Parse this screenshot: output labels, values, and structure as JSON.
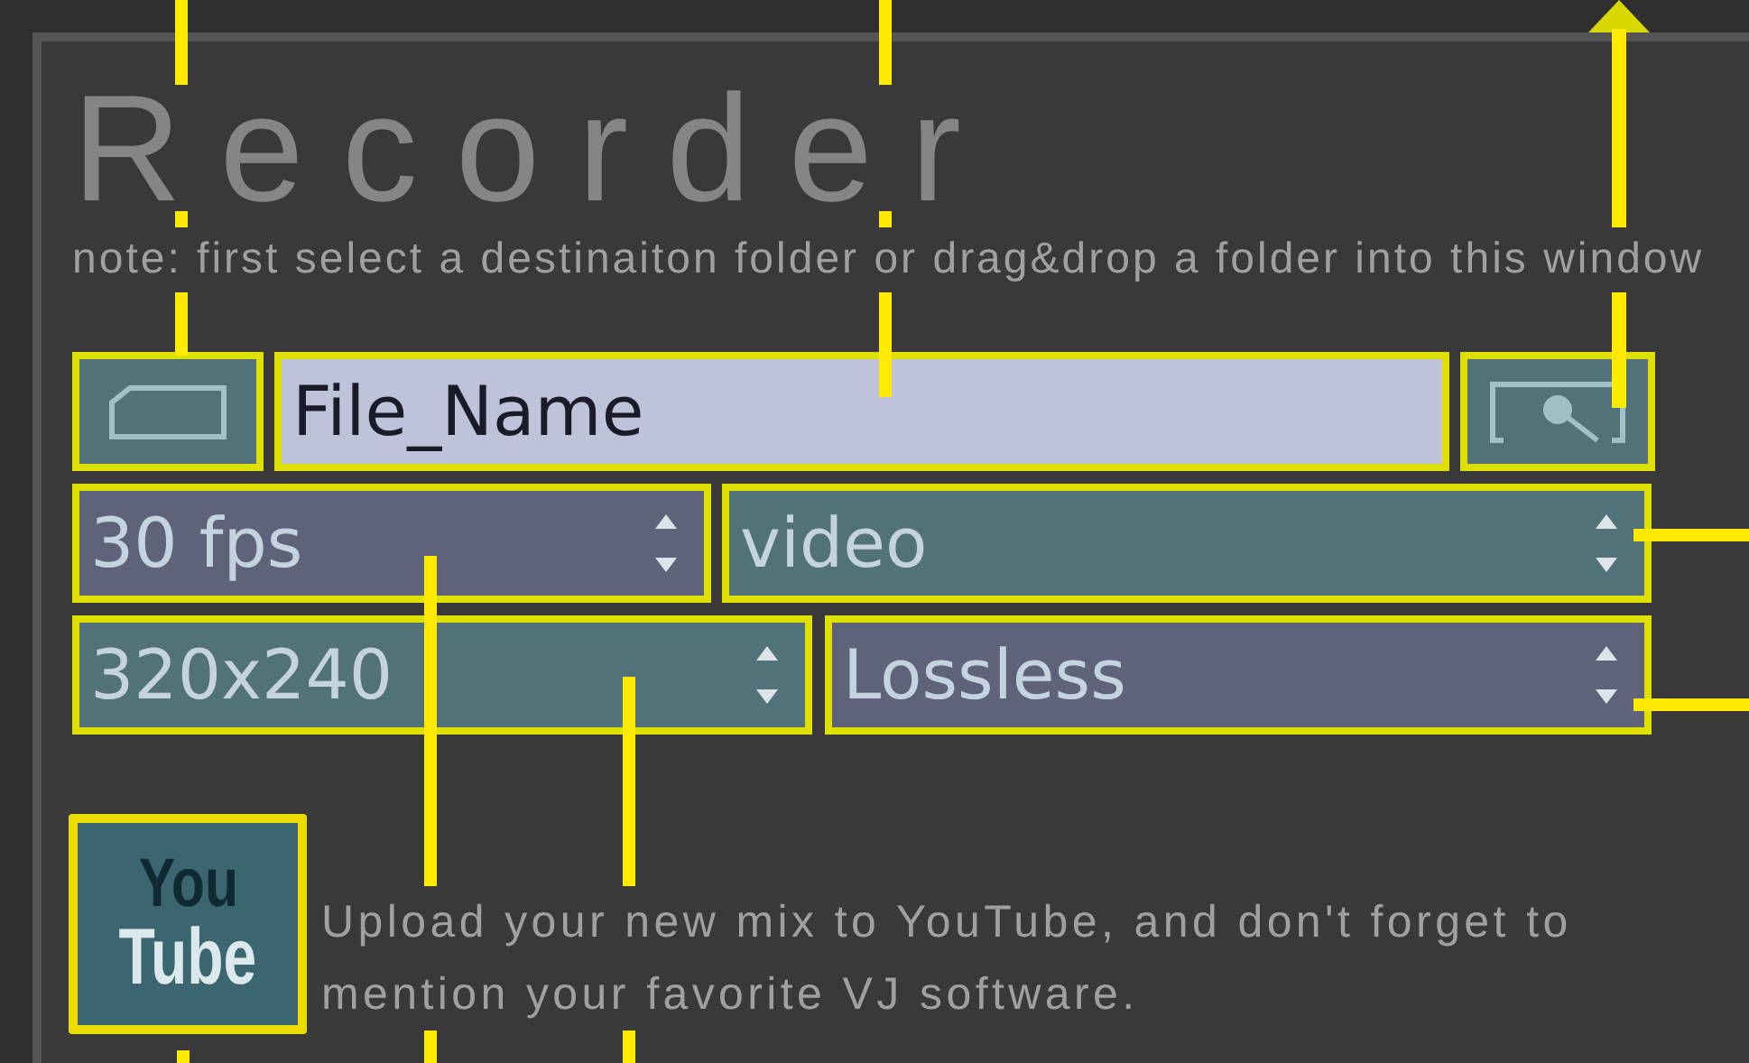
{
  "title": "Recorder",
  "note": "note: first select a destinaiton folder or drag&drop a folder into this window",
  "file_name": {
    "value": "File_Name"
  },
  "selects": [
    {
      "value": "30 fps",
      "color": "#5f637a"
    },
    {
      "value": "video",
      "color": "#52727a"
    },
    {
      "value": "320x240",
      "color": "#52727a"
    },
    {
      "value": "Lossless",
      "color": "#5f637a"
    }
  ],
  "youtube": {
    "logo_top": "You",
    "logo_bottom": "Tube",
    "text": "Upload your new mix to YouTube, and don't forget to mention your favorite VJ software."
  }
}
